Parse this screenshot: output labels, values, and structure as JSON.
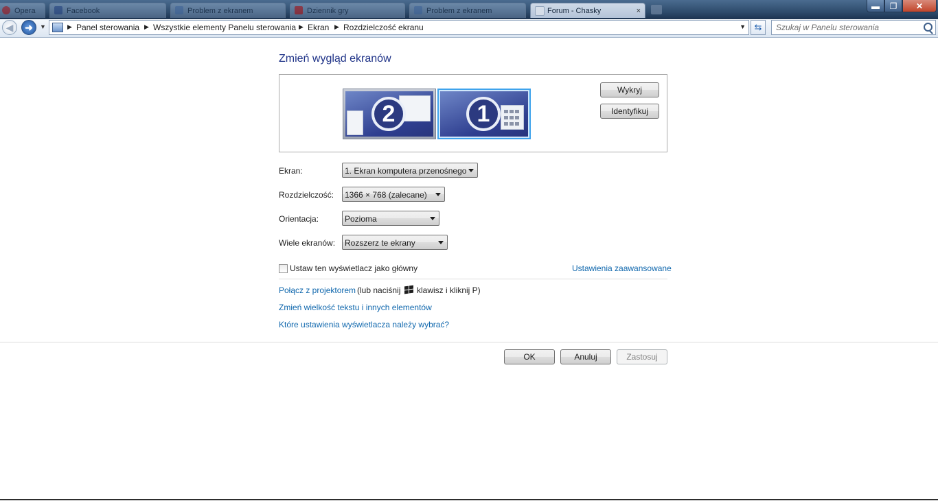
{
  "tabs": [
    {
      "label": "Opera"
    },
    {
      "label": "Facebook"
    },
    {
      "label": ""
    },
    {
      "label": "Problem z ekranem"
    },
    {
      "label": "Dziennik gry"
    },
    {
      "label": "Problem z ekranem"
    },
    {
      "label": "Forum - Chasky"
    }
  ],
  "window_controls": {
    "minimize": "▬",
    "maximize": "❐",
    "close": "✕"
  },
  "breadcrumb": {
    "items": [
      "Panel sterowania",
      "Wszystkie elementy Panelu sterowania",
      "Ekran",
      "Rozdzielczość ekranu"
    ]
  },
  "search": {
    "placeholder": "Szukaj w Panelu sterowania"
  },
  "page": {
    "title": "Zmień wygląd ekranów"
  },
  "monitors": {
    "secondary_number": "2",
    "primary_number": "1",
    "detect_label": "Wykryj",
    "identify_label": "Identyfikuj"
  },
  "settings": {
    "display_label": "Ekran:",
    "display_value": "1. Ekran komputera przenośnego",
    "resolution_label": "Rozdzielczość:",
    "resolution_value": "1366 × 768 (zalecane)",
    "orientation_label": "Orientacja:",
    "orientation_value": "Pozioma",
    "multiple_label": "Wiele ekranów:",
    "multiple_value": "Rozszerz te ekrany"
  },
  "main_display_checkbox": {
    "label": "Ustaw ten wyświetlacz jako główny",
    "checked": false
  },
  "links": {
    "advanced": "Ustawienia zaawansowane",
    "projector": "Połącz z projektorem",
    "projector_hint_start": "(lub naciśnij",
    "projector_hint_end": "klawisz i kliknij P)",
    "text_size": "Zmień wielkość tekstu i innych elementów",
    "which_settings": "Które ustawienia wyświetlacza należy wybrać?"
  },
  "dialog_buttons": {
    "ok": "OK",
    "cancel": "Anuluj",
    "apply": "Zastosuj"
  },
  "colors": {
    "title": "#1e3287",
    "link": "#0f67ad",
    "selected_monitor": "#3fa3ec"
  }
}
